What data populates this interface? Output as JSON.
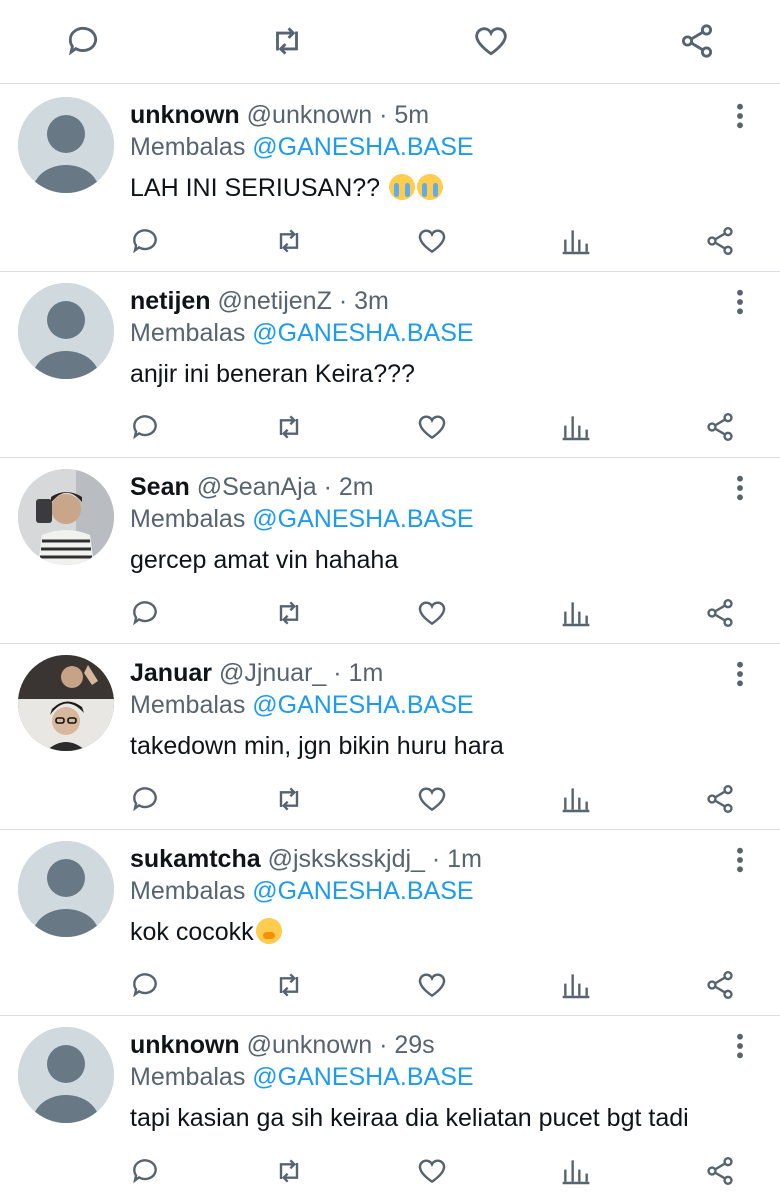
{
  "top_actions": [
    "reply-icon",
    "retweet-icon",
    "like-icon",
    "share-icon"
  ],
  "tweets": [
    {
      "name": "unknown",
      "handle": "@unknown",
      "time": "· 5m",
      "reply_prefix": "Membalas",
      "reply_to": "@GANESHA.BASE",
      "text": "LAH INI SERIUSAN??",
      "emoji": "loudly-crying-face x2",
      "avatar": "default"
    },
    {
      "name": "netijen",
      "handle": "@netijenZ",
      "time": "· 3m",
      "reply_prefix": "Membalas",
      "reply_to": "@GANESHA.BASE",
      "text": "anjir ini beneran Keira???",
      "avatar": "default"
    },
    {
      "name": "Sean",
      "handle": "@SeanAja",
      "time": "· 2m",
      "reply_prefix": "Membalas",
      "reply_to": "@GANESHA.BASE",
      "text": "gercep amat vin hahaha",
      "avatar": "photo"
    },
    {
      "name": "Januar",
      "handle": "@Jjnuar_",
      "time": "· 1m",
      "reply_prefix": "Membalas",
      "reply_to": "@GANESHA.BASE",
      "text": "takedown min, jgn bikin huru hara",
      "avatar": "photo"
    },
    {
      "name": "sukamtcha",
      "handle": "@jsksksskjdj_",
      "time": "· 1m",
      "reply_prefix": "Membalas",
      "reply_to": "@GANESHA.BASE",
      "text": "kok cocokk",
      "emoji": "face-with-hand-over-mouth",
      "avatar": "default"
    },
    {
      "name": "unknown",
      "handle": "@unknown",
      "time": "· 29s",
      "reply_prefix": "Membalas",
      "reply_to": "@GANESHA.BASE",
      "text": "tapi kasian ga sih keiraa dia keliatan pucet bgt tadi",
      "avatar": "default"
    }
  ],
  "colors": {
    "link": "#1d9bf0",
    "secondary": "#566471",
    "divider": "#d9dde1",
    "avatar_bg": "#cfd9de"
  }
}
